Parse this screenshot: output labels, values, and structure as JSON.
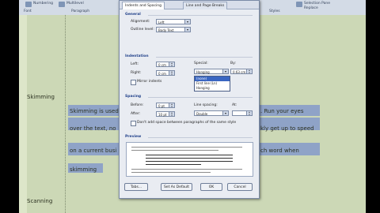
{
  "ribbon": {
    "left_labels": [
      "Numbering",
      "Multilevel",
      "Paragraph"
    ],
    "group_labels": [
      "Font",
      "Paragraph",
      "Styles"
    ],
    "right_labels": [
      "Selection Pane",
      "Replace"
    ]
  },
  "document": {
    "heading1": "Skimming",
    "para_lines": [
      "Skimming is used",
      "over the text, no",
      "on a current busi",
      "skimming"
    ],
    "para_right": [
      ". Run your eyes",
      "kly get up to speed",
      "ch word when"
    ],
    "heading2": "Scanning"
  },
  "dialog": {
    "tabs": [
      "Indents and Spacing",
      "Line and Page Breaks"
    ],
    "general": {
      "title": "General",
      "alignment_label": "Alignment:",
      "alignment_value": "Left",
      "outline_label": "Outline level:",
      "outline_value": "Body Text"
    },
    "indentation": {
      "title": "Indentation",
      "left_label": "Left:",
      "left_value": "0 cm",
      "right_label": "Right:",
      "right_value": "0 cm",
      "mirror_label": "Mirror indents",
      "special_label": "Special:",
      "special_value": "Hanging",
      "by_label": "By:",
      "by_value": "0.63 cm",
      "special_options": [
        "(none)",
        "First line (Ln)",
        "Hanging"
      ]
    },
    "spacing": {
      "title": "Spacing",
      "before_label": "Before:",
      "before_value": "0 pt",
      "after_label": "After:",
      "after_value": "10 pt",
      "line_spacing_label": "Line spacing:",
      "line_spacing_value": "Double",
      "at_label": "At:",
      "dont_add_label": "Don't add space between paragraphs of the same style"
    },
    "preview": {
      "title": "Preview"
    },
    "buttons": {
      "tabs": "Tabs...",
      "default": "Set As Default",
      "ok": "OK",
      "cancel": "Cancel"
    }
  }
}
